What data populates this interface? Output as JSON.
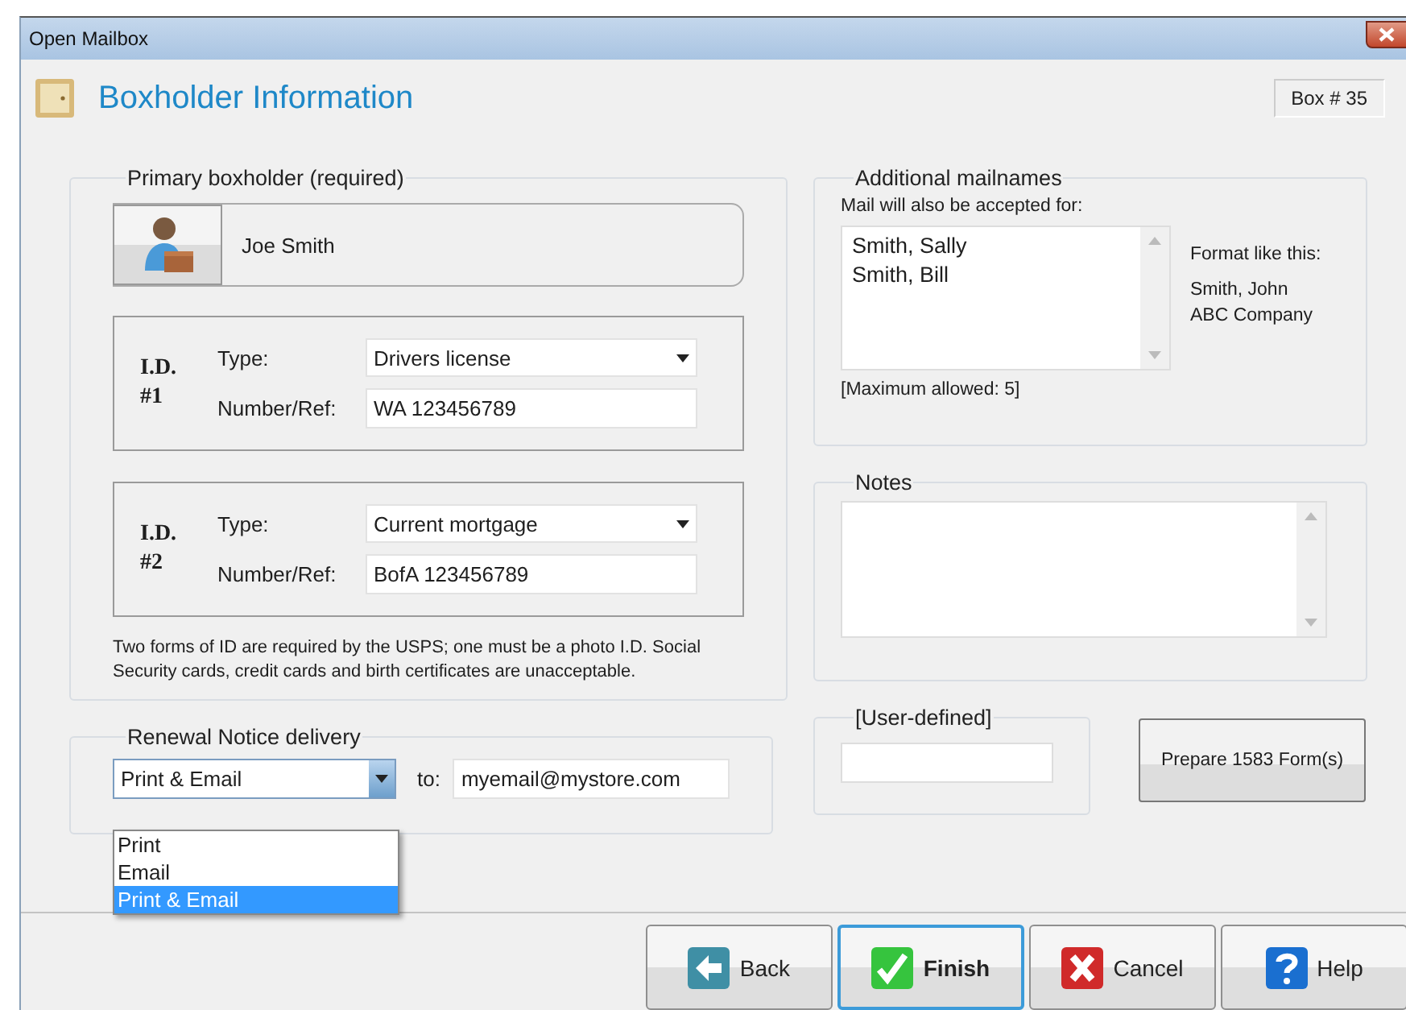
{
  "window": {
    "title": "Open Mailbox"
  },
  "header": {
    "title": "Boxholder Information",
    "box_label": "Box # 35"
  },
  "primary": {
    "legend": "Primary boxholder (required)",
    "name": "Joe Smith",
    "ids": [
      {
        "label": "I.D. #1",
        "type_label": "Type:",
        "type_value": "Drivers license",
        "number_label": "Number/Ref:",
        "number_value": "WA 123456789"
      },
      {
        "label": "I.D. #2",
        "type_label": "Type:",
        "type_value": "Current mortgage",
        "number_label": "Number/Ref:",
        "number_value": "BofA 123456789"
      }
    ],
    "note": "Two forms of ID are required by the USPS; one must be a photo I.D. Social Security cards, credit cards and birth certificates are unacceptable."
  },
  "renewal": {
    "legend": "Renewal Notice delivery",
    "value": "Print & Email",
    "expanded": true,
    "options": [
      {
        "label": "Print",
        "selected": false
      },
      {
        "label": "Email",
        "selected": false
      },
      {
        "label": "Print & Email",
        "selected": true
      }
    ],
    "to_label": "to:",
    "email": "myemail@mystore.com"
  },
  "mailnames": {
    "legend": "Additional mailnames",
    "prompt": "Mail will also be accepted for:",
    "names": [
      "Smith, Sally",
      "Smith, Bill"
    ],
    "format_label": "Format like this:",
    "format_examples": [
      "Smith, John",
      "ABC Company"
    ],
    "max_note": "[Maximum allowed: 5]"
  },
  "notes": {
    "legend": "Notes"
  },
  "user_defined": {
    "legend": "[User-defined]"
  },
  "prepare_button": "Prepare 1583 Form(s)",
  "footer_buttons": [
    {
      "kind": "back",
      "label": "Back",
      "default": false
    },
    {
      "kind": "finish",
      "label": "Finish",
      "default": true
    },
    {
      "kind": "cancel",
      "label": "Cancel",
      "default": false
    },
    {
      "kind": "help",
      "label": "Help",
      "default": false
    }
  ]
}
